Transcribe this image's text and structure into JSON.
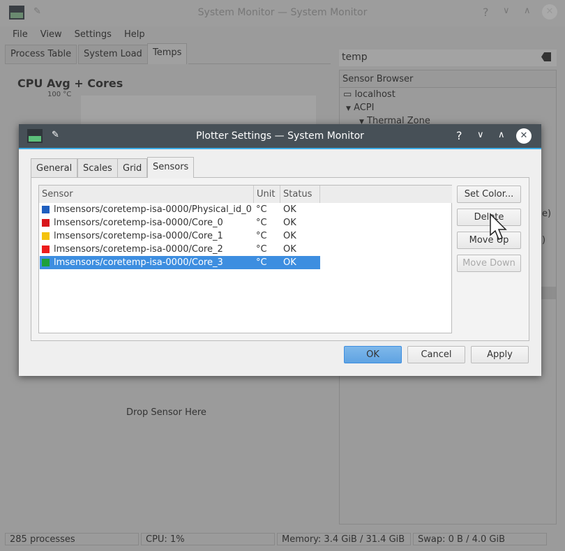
{
  "window": {
    "title": "System Monitor — System Monitor"
  },
  "menu": [
    {
      "label": "File"
    },
    {
      "label": "View"
    },
    {
      "label": "Settings"
    },
    {
      "label": "Help"
    }
  ],
  "tabs": [
    {
      "label": "Process Table"
    },
    {
      "label": "System Load"
    },
    {
      "label": "Temps",
      "active": true
    }
  ],
  "search": {
    "value": "temp"
  },
  "sensor_browser": {
    "header": "Sensor Browser",
    "items": [
      {
        "label": "localhost",
        "icon": "monitor-icon"
      },
      {
        "label": "ACPI",
        "icon": "triangle-down-icon"
      },
      {
        "label": "Thermal Zone",
        "icon": "triangle-down-icon"
      }
    ],
    "partial_texts": [
      "e)",
      ")"
    ]
  },
  "plot": {
    "title": "CPU Avg + Cores",
    "ymax_label": "100 °C",
    "drop_label": "Drop Sensor Here"
  },
  "statusbar": {
    "processes": "285 processes",
    "cpu": "CPU: 1%",
    "memory": "Memory: 3.4 GiB / 31.4 GiB",
    "swap": "Swap: 0 B / 4.0 GiB"
  },
  "dialog": {
    "title": "Plotter Settings — System Monitor",
    "tabs": [
      {
        "label": "General"
      },
      {
        "label": "Scales"
      },
      {
        "label": "Grid"
      },
      {
        "label": "Sensors",
        "active": true
      }
    ],
    "columns": [
      "Sensor",
      "Unit",
      "Status"
    ],
    "rows": [
      {
        "sensor": "lmsensors/coretemp-isa-0000/Physical_id_0",
        "unit": "°C",
        "status": "OK",
        "color": "#1f5fbf"
      },
      {
        "sensor": "lmsensors/coretemp-isa-0000/Core_0",
        "unit": "°C",
        "status": "OK",
        "color": "#d8161b"
      },
      {
        "sensor": "lmsensors/coretemp-isa-0000/Core_1",
        "unit": "°C",
        "status": "OK",
        "color": "#f4c20d"
      },
      {
        "sensor": "lmsensors/coretemp-isa-0000/Core_2",
        "unit": "°C",
        "status": "OK",
        "color": "#ec1c1c"
      },
      {
        "sensor": "lmsensors/coretemp-isa-0000/Core_3",
        "unit": "°C",
        "status": "OK",
        "color": "#1ea03c",
        "selected": true
      }
    ],
    "buttons": {
      "set_color": "Set Color...",
      "delete": "Delete",
      "move_up": "Move Up",
      "move_down": "Move Down",
      "ok": "OK",
      "cancel": "Cancel",
      "apply": "Apply"
    }
  }
}
